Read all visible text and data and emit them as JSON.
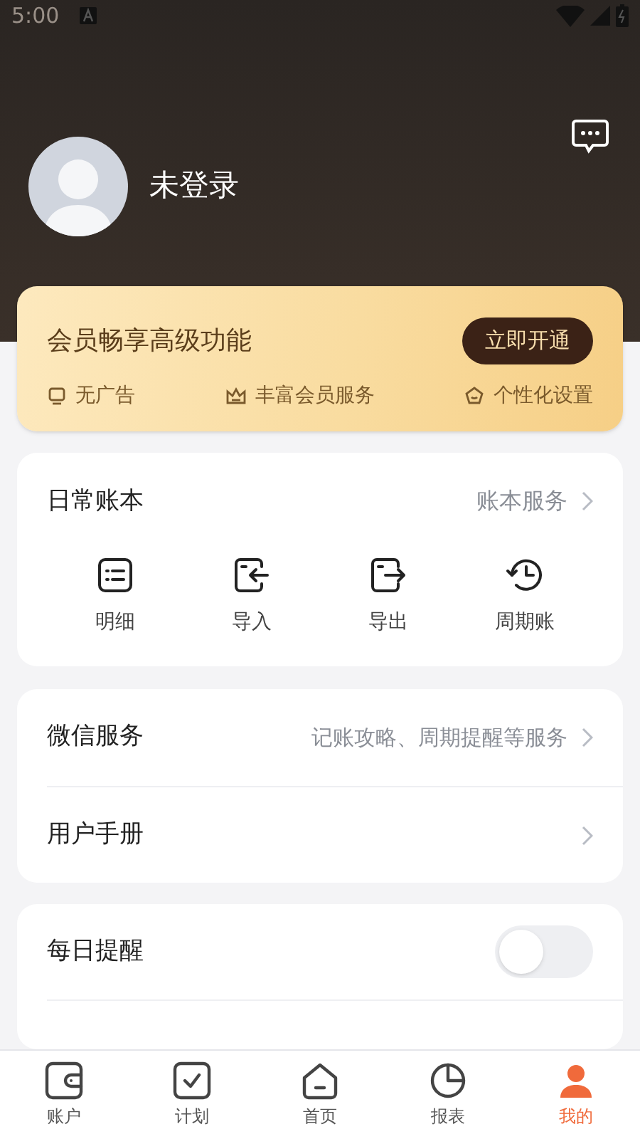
{
  "status_bar": {
    "time": "5:00"
  },
  "profile": {
    "name": "未登录"
  },
  "membership": {
    "title": "会员畅享高级功能",
    "button": "立即开通",
    "perks": [
      {
        "kind": "no-ads",
        "label": "无广告"
      },
      {
        "kind": "crown",
        "label": "丰富会员服务"
      },
      {
        "kind": "pentagon",
        "label": "个性化设置"
      }
    ]
  },
  "ledger": {
    "title": "日常账本",
    "link": "账本服务",
    "actions": [
      {
        "kind": "details",
        "label": "明细"
      },
      {
        "kind": "import",
        "label": "导入"
      },
      {
        "kind": "export",
        "label": "导出"
      },
      {
        "kind": "recurring",
        "label": "周期账"
      }
    ]
  },
  "services": [
    {
      "label": "微信服务",
      "detail": "记账攻略、周期提醒等服务"
    },
    {
      "label": "用户手册"
    }
  ],
  "reminders": [
    {
      "label": "每日提醒",
      "on": false
    }
  ],
  "tab_bar": [
    {
      "kind": "wallet",
      "label": "账户",
      "selected": false
    },
    {
      "kind": "plan",
      "label": "计划",
      "selected": false
    },
    {
      "kind": "home",
      "label": "首页",
      "selected": false
    },
    {
      "kind": "report",
      "label": "报表",
      "selected": false
    },
    {
      "kind": "me",
      "label": "我的",
      "selected": true
    }
  ]
}
